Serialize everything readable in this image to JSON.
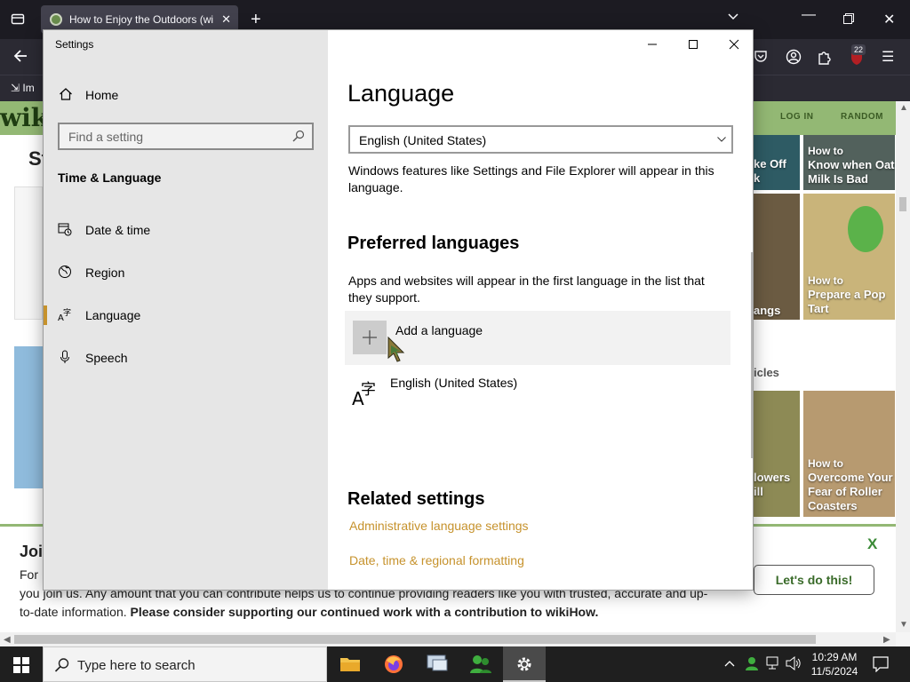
{
  "browser": {
    "tab_title": "How to Enjoy the Outdoors (wi",
    "bookmark_label": "Im",
    "notification_count": "22"
  },
  "webpage": {
    "logo_text": "wik",
    "nav": [
      "LOG IN",
      "RANDOM"
    ],
    "heading_fragment": "St",
    "section_fragment": "icles",
    "cards": [
      {
        "prefix": "How to",
        "title": "Know when Oat Milk Is Bad"
      },
      {
        "prefix": "How to",
        "title": "Prepare a Pop Tart"
      },
      {
        "prefix": "How to",
        "title": "Overcome Your Fear of Roller Coasters"
      }
    ],
    "card_fragments": [
      "ke Off",
      "k",
      "angs",
      "lowers",
      "ill"
    ],
    "support": {
      "title": "Joi",
      "line1": "For",
      "line2": "you join us. Any amount that you can contribute helps us to continue providing readers like you with trusted, accurate and up-",
      "line3_plain": "to-date information.",
      "line3_bold": "Please consider supporting our continued work with a contribution to wikiHow.",
      "button": "Let's do this!",
      "close": "X"
    }
  },
  "settings": {
    "window_title": "Settings",
    "sidebar": {
      "home": "Home",
      "search_placeholder": "Find a setting",
      "section": "Time & Language",
      "items": [
        {
          "label": "Date & time",
          "icon": "date-time-icon"
        },
        {
          "label": "Region",
          "icon": "region-icon"
        },
        {
          "label": "Language",
          "icon": "language-icon",
          "active": true
        },
        {
          "label": "Speech",
          "icon": "microphone-icon"
        }
      ]
    },
    "content": {
      "title": "Language",
      "display_language": "English (United States)",
      "display_desc": "Windows features like Settings and File Explorer will appear in this language.",
      "preferred_heading": "Preferred languages",
      "preferred_desc": "Apps and websites will appear in the first language in the list that they support.",
      "add_language": "Add a language",
      "installed_language": "English (United States)",
      "related_heading": "Related settings",
      "links": [
        "Administrative language settings",
        "Date, time & regional formatting"
      ]
    },
    "accent_color": "#c6922c"
  },
  "taskbar": {
    "search_placeholder": "Type here to search",
    "time": "10:29 AM",
    "date": "11/5/2024"
  }
}
